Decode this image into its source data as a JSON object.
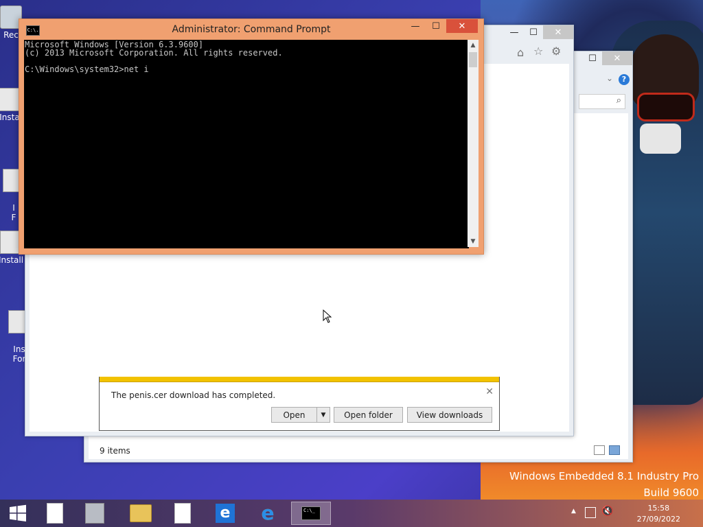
{
  "desktop": {
    "icons": [
      "Rec",
      "Insta",
      "I\nF",
      "Install",
      "Ins\nFor"
    ]
  },
  "cmd": {
    "title": "Administrator: Command Prompt",
    "icon_label": "C:\\.",
    "lines": [
      "Microsoft Windows [Version 6.3.9600]",
      "(c) 2013 Microsoft Corporation. All rights reserved.",
      "",
      "C:\\Windows\\system32>net i"
    ],
    "minimize": "—",
    "maximize": "☐",
    "close": "✕"
  },
  "explorer": {
    "status_items": "9 items",
    "search_icon": "⌕",
    "help": "?"
  },
  "download_bar": {
    "message": "The penis.cer download has completed.",
    "open_label": "Open",
    "open_folder_label": "Open folder",
    "view_downloads_label": "View downloads",
    "close": "✕"
  },
  "watermark": {
    "line1": "Windows Embedded 8.1 Industry Pro",
    "line2": "Build 9600"
  },
  "clock": {
    "time": "15:58",
    "date": "27/09/2022"
  },
  "colors": {
    "cmd_frame": "#f0a070",
    "cmd_close": "#d9513b",
    "download_stripe": "#f2c200"
  }
}
